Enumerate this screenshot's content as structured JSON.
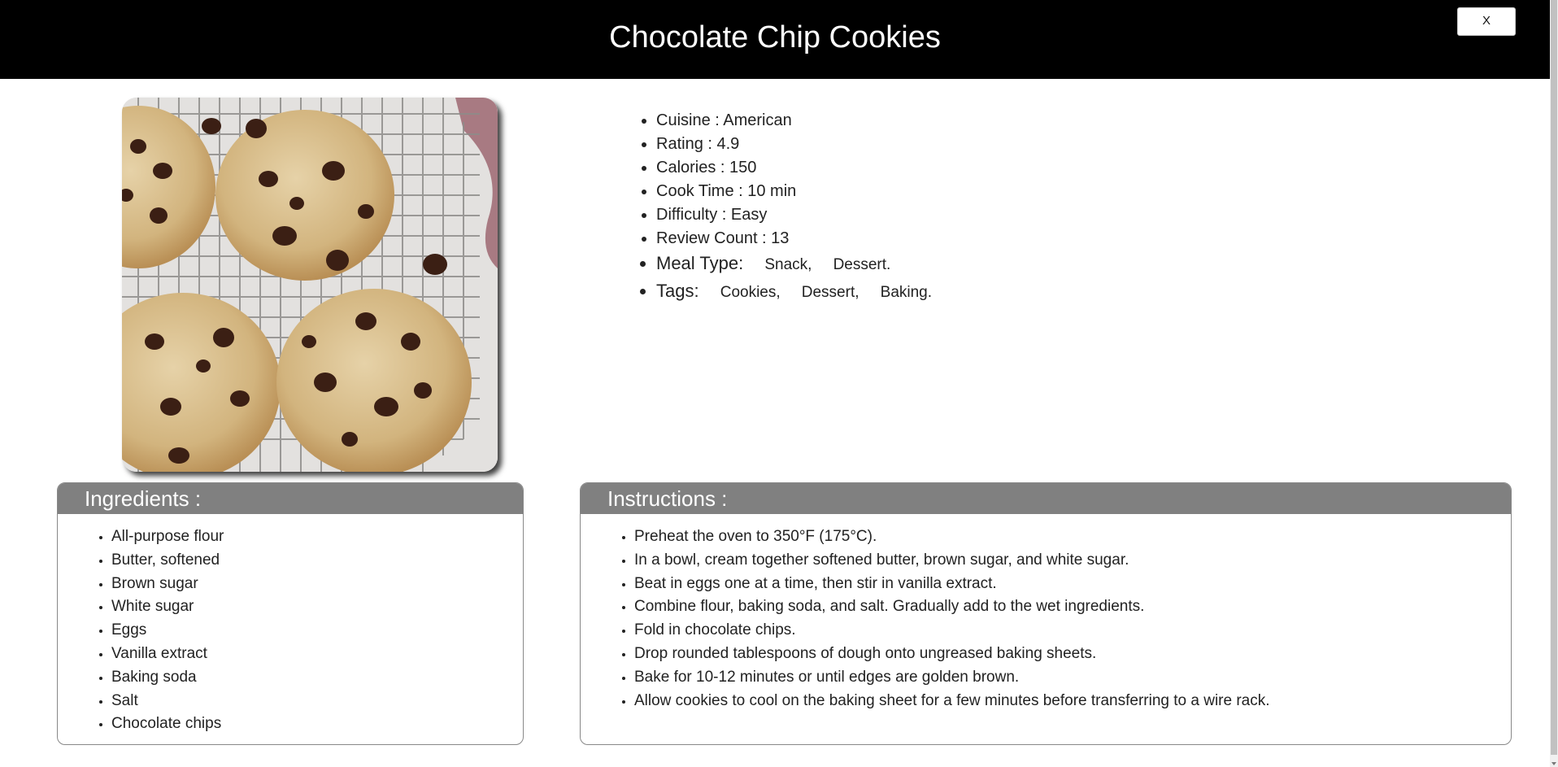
{
  "header": {
    "title": "Chocolate Chip Cookies",
    "close_label": "X"
  },
  "image": {
    "subject": "chocolate chip cookies on wire cooling rack"
  },
  "details": {
    "cuisine": "Cuisine : American",
    "rating": "Rating : 4.9",
    "calories": "Calories : 150",
    "cook_time": "Cook Time : 10 min",
    "difficulty": "Difficulty : Easy",
    "review_count": "Review Count : 13",
    "meal_type_label": "Meal Type:",
    "meal_types": [
      "Snack,",
      "Dessert."
    ],
    "tags_label": "Tags:",
    "tags": [
      "Cookies,",
      "Dessert,",
      "Baking."
    ]
  },
  "ingredients": {
    "heading": "Ingredients :",
    "items": [
      "All-purpose flour",
      "Butter, softened",
      "Brown sugar",
      "White sugar",
      "Eggs",
      "Vanilla extract",
      "Baking soda",
      "Salt",
      "Chocolate chips"
    ]
  },
  "instructions": {
    "heading": "Instructions :",
    "steps": [
      "Preheat the oven to 350°F (175°C).",
      "In a bowl, cream together softened butter, brown sugar, and white sugar.",
      "Beat in eggs one at a time, then stir in vanilla extract.",
      "Combine flour, baking soda, and salt. Gradually add to the wet ingredients.",
      "Fold in chocolate chips.",
      "Drop rounded tablespoons of dough onto ungreased baking sheets.",
      "Bake for 10-12 minutes or until edges are golden brown.",
      "Allow cookies to cool on the baking sheet for a few minutes before transferring to a wire rack."
    ]
  },
  "colors": {
    "header_bg": "#000000",
    "panel_header_bg": "#808080"
  }
}
